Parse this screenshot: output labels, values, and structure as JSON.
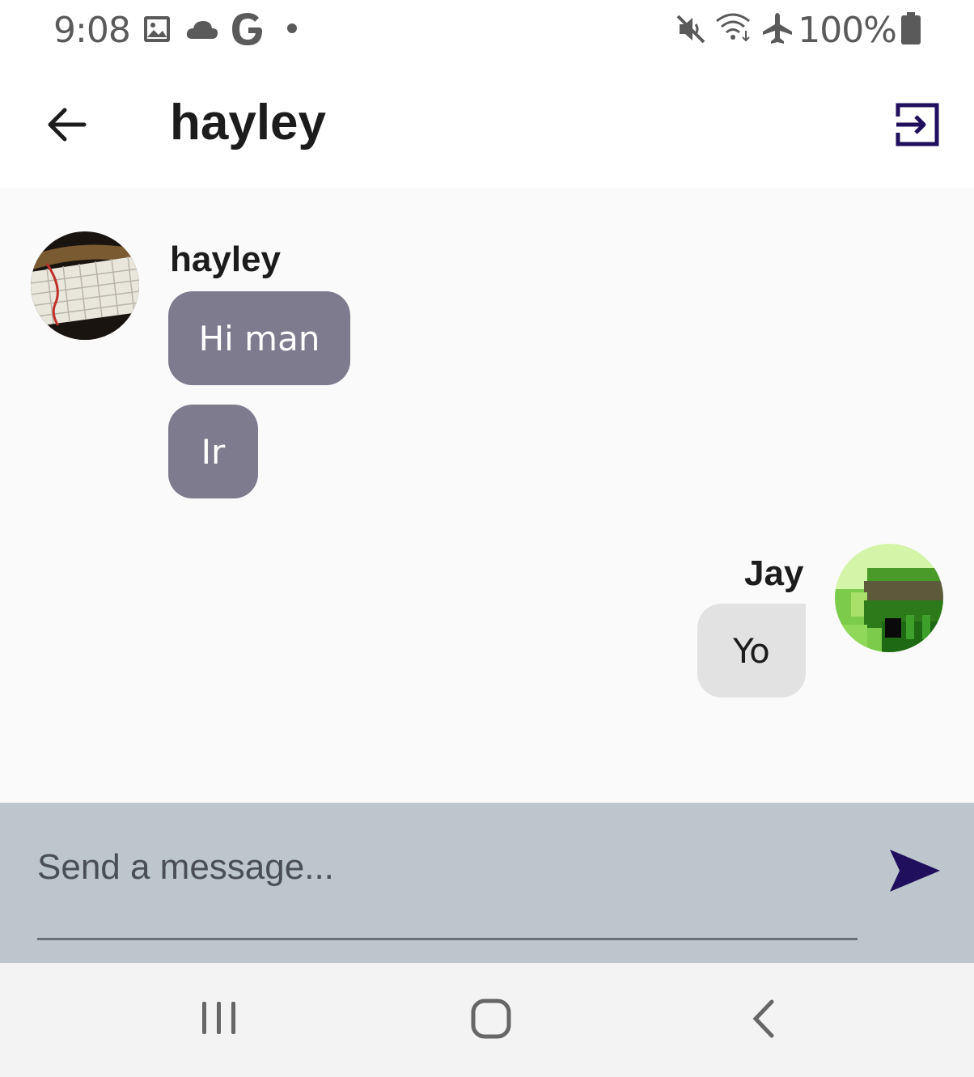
{
  "status_bar": {
    "time": "9:08",
    "battery_percent": "100%",
    "icons": [
      "gallery-icon",
      "cloud-icon",
      "google-icon",
      "dot-icon",
      "mute-icon",
      "wifi-icon",
      "airplane-icon",
      "battery-icon"
    ]
  },
  "header": {
    "title": "hayley",
    "back_icon": "arrow-left-icon",
    "action_icon": "exit-to-app-icon"
  },
  "messages": [
    {
      "sender": "hayley",
      "text": "Hi man",
      "direction": "incoming"
    },
    {
      "sender": "hayley",
      "text": "Ir",
      "direction": "incoming"
    },
    {
      "sender": "Jay",
      "text": "Yo",
      "direction": "outgoing"
    }
  ],
  "message_groups": {
    "incoming_sender": "hayley",
    "outgoing_sender": "Jay"
  },
  "composer": {
    "placeholder": "Send a message...",
    "value": "",
    "send_icon": "send-icon"
  },
  "nav_bar": {
    "icons": [
      "recent-apps-icon",
      "home-icon",
      "back-icon"
    ]
  },
  "colors": {
    "incoming_bubble": "#7e7b8e",
    "outgoing_bubble": "#e2e2e2",
    "composer_bg": "#bdc6cd",
    "accent": "#1f0f5c"
  }
}
